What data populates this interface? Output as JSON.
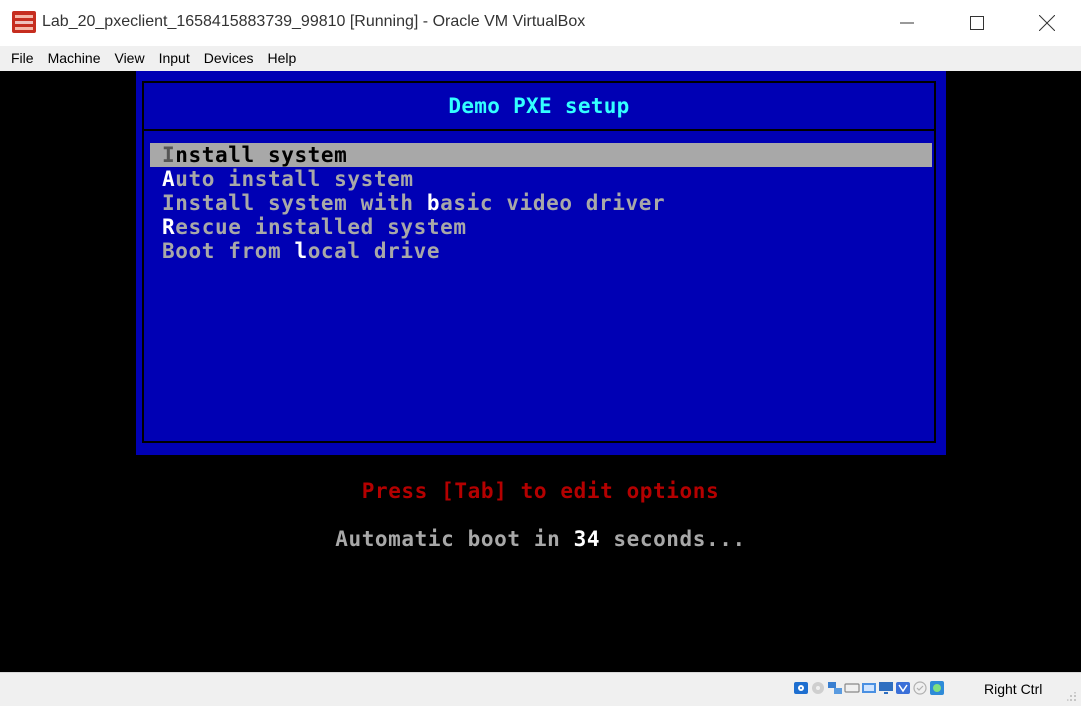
{
  "window": {
    "title": "Lab_20_pxeclient_1658415883739_99810 [Running] - Oracle VM VirtualBox"
  },
  "menubar": {
    "items": [
      "File",
      "Machine",
      "View",
      "Input",
      "Devices",
      "Help"
    ]
  },
  "boot_menu": {
    "title": "Demo PXE setup",
    "entries": [
      {
        "pre": "",
        "hotkey": "I",
        "post": "nstall system",
        "selected": true
      },
      {
        "pre": "",
        "hotkey": "A",
        "post": "uto install system",
        "selected": false
      },
      {
        "pre": "Install system with ",
        "hotkey": "b",
        "post": "asic video driver",
        "selected": false
      },
      {
        "pre": "",
        "hotkey": "R",
        "post": "escue installed system",
        "selected": false
      },
      {
        "pre": "Boot from ",
        "hotkey": "l",
        "post": "ocal drive",
        "selected": false
      }
    ],
    "tab_hint": "Press [Tab] to edit options",
    "auto_boot_prefix": "Automatic boot in ",
    "auto_boot_seconds": "34",
    "auto_boot_suffix": " seconds..."
  },
  "statusbar": {
    "icons": [
      "hard-disk-icon",
      "optical-drive-icon",
      "network-icon",
      "usb-icon",
      "shared-folders-icon",
      "display-icon",
      "video-capture-icon",
      "cpu-icon",
      "mouse-integration-icon",
      "keyboard-icon"
    ],
    "host_key": "Right Ctrl"
  },
  "colors": {
    "boot_background": "#0000b4",
    "boot_title": "#33ffff",
    "tab_hint": "#b40000",
    "text_gray": "#a8a8a8"
  }
}
